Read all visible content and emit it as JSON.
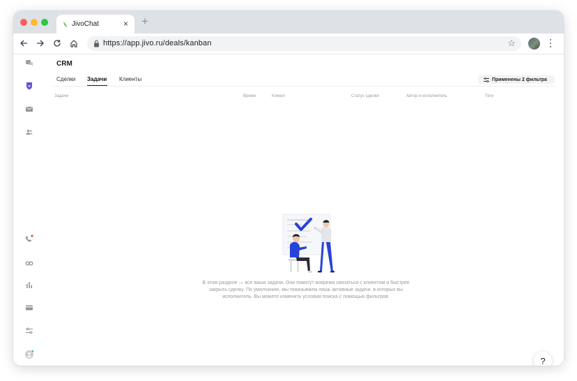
{
  "browser": {
    "tab_title": "JivoChat",
    "tab_close": "×",
    "new_tab": "+",
    "url": "https://app.jivo.ru/deals/kanban",
    "star": "☆"
  },
  "crm": {
    "title": "CRM",
    "tabs": [
      {
        "label": "Сделки",
        "active": false
      },
      {
        "label": "Задачи",
        "active": true
      },
      {
        "label": "Клиенты",
        "active": false
      }
    ],
    "filter_label": "Применены 2 фильтра",
    "columns": [
      "Задачи",
      "Время",
      "Клиент",
      "Статус сделки",
      "Автор и исполнитель",
      "Теги"
    ],
    "empty_message": "В этом разделе — все ваши задачи. Они помогут вовремя связаться с клиентом и быстрее закрыть сделку. По умолчанию, мы показываем лишь активные задачи, в которых вы исполнитель. Вы можете изменить условия поиска с помощью фильтров.",
    "help_label": "?"
  },
  "sidebar": {
    "top_icons": [
      "chats-icon",
      "crm-shield-icon",
      "mail-icon",
      "contacts-icon"
    ],
    "bottom_icons": [
      "phone-icon",
      "binoculars-icon",
      "stats-icon",
      "billing-icon",
      "settings-sliders-icon",
      "user-avatar-icon"
    ],
    "notification_color": "#e8503a",
    "active_color": "#6a53d6",
    "online_color": "#3cc65a"
  },
  "colors": {
    "brand_green": "#48c240",
    "illustration_blue": "#2742d9"
  }
}
